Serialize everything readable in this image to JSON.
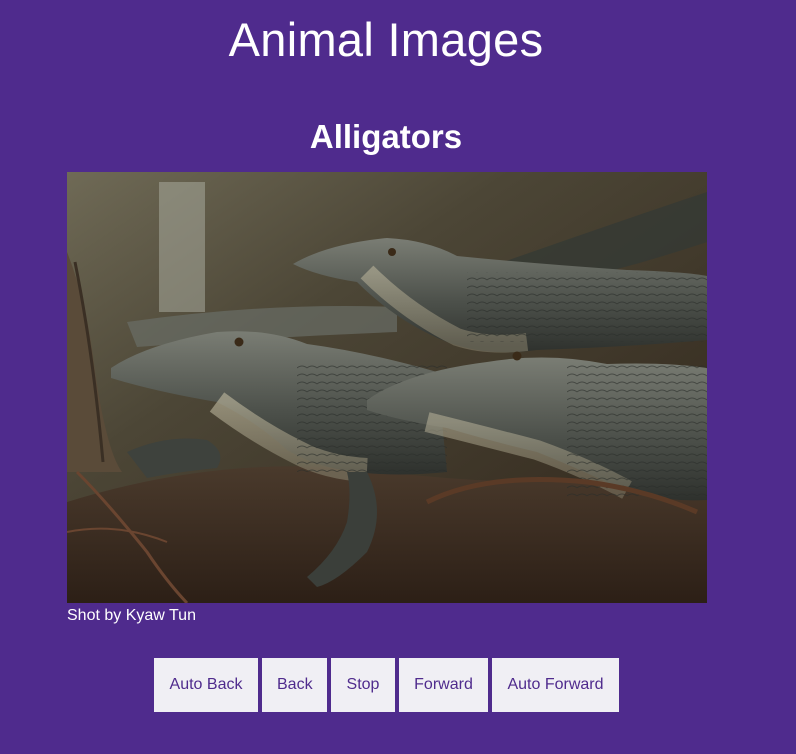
{
  "page": {
    "title": "Animal Images",
    "background": "#4f2b8d"
  },
  "slide": {
    "title": "Alligators",
    "image_subject": "group of alligators resting on dirt",
    "caption": "Shot by Kyaw Tun"
  },
  "controls": {
    "auto_back": "Auto Back",
    "back": "Back",
    "stop": "Stop",
    "forward": "Forward",
    "auto_forward": "Auto Forward",
    "button_bg": "#f0eff4",
    "button_text_color": "#4f2b8d"
  }
}
